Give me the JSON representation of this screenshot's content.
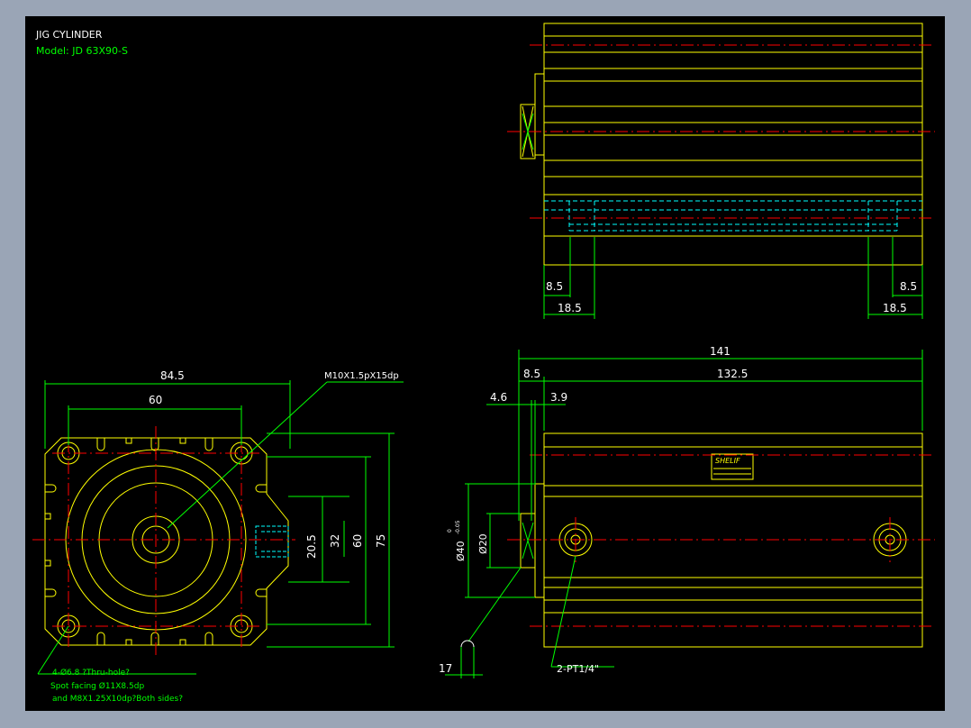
{
  "title_block": {
    "title": "JIG CYLINDER",
    "model": "Model:  JD 63X90-S"
  },
  "colors": {
    "background": "#000000",
    "frame": "#9aa5b6",
    "outline": "#ffff00",
    "dimension": "#00ff00",
    "centerline": "#ff0000",
    "hidden": "#00ffff",
    "text_white": "#ffffff"
  },
  "front_view": {
    "dim_width_outer": "84.5",
    "dim_width_inner": "60",
    "dim_20_5": "20.5",
    "dim_32": "32",
    "dim_60": "60",
    "dim_75": "75",
    "thread_callout": "M10X1.5pX15dp",
    "note_line1": "4-Ø6.8  ?Thru-hole?",
    "note_line2": "Spot facing  Ø11X8.5dp",
    "note_line3": "and M8X1.25X10dp?Both sides?"
  },
  "top_view": {
    "dim_left_small": "8.5",
    "dim_left_large": "18.5",
    "dim_right_small": "8.5",
    "dim_right_large": "18.5"
  },
  "side_view": {
    "dim_overall": "141",
    "dim_body": "132.5",
    "dim_8_5": "8.5",
    "dim_4_6": "4.6",
    "dim_3_9": "3.9",
    "dim_rod_dia": "Ø20",
    "dim_bore_dia": "Ø40",
    "dim_tolerance_upper": "0",
    "dim_tolerance_lower": "-0.05",
    "dim_17": "17",
    "port_callout": "2-PT1/4\"",
    "label_brand": "SHELIF"
  }
}
